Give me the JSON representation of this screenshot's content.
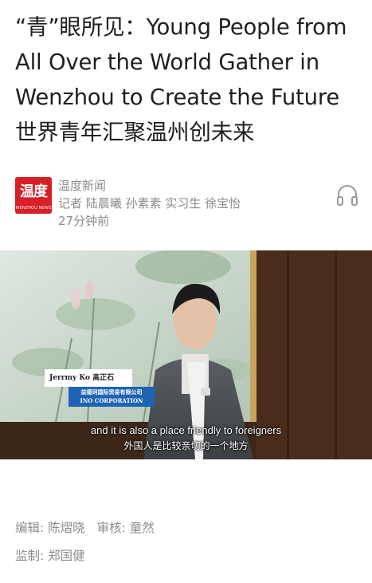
{
  "article": {
    "title": "“青”眼所见：Young People from All Over the World Gather in Wenzhou to Create the Future 世界青年汇聚温州创未来"
  },
  "source": {
    "logo_text": "温度",
    "logo_sub": "WENZHOU NEWS",
    "name": "温度新闻",
    "authors": "记者  陆晨曦 孙素素 实习生 徐宝怡",
    "time": "27分钟前",
    "audio_icon": "headphones-icon"
  },
  "video": {
    "nameplate_name": "Jerrmy Ko 高正石",
    "nameplate_company_zh": "益德珂国际贸易有限公司",
    "nameplate_company_en": "INO CORPORATION",
    "subtitle_en": "and it is also a place friendly to foreigners",
    "subtitle_zh": "外国人是比较亲切的一个地方"
  },
  "credits": {
    "editor_label": "编辑:",
    "editor_name": "陈熠晓",
    "reviewer_label": "审核:",
    "reviewer_name": "童然",
    "supervisor_label": "监制:",
    "supervisor_name": "郑国健"
  },
  "colors": {
    "brand_red": "#d61f26",
    "meta_gray": "#8c8c8c",
    "nameplate_blue": "#1e63b5"
  }
}
